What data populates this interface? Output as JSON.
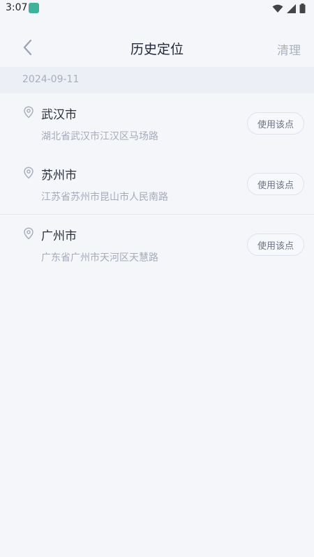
{
  "status": {
    "time": "3:07"
  },
  "header": {
    "title": "历史定位",
    "clear_label": "清理"
  },
  "date_group": "2024-09-11",
  "items": [
    {
      "city": "武汉市",
      "address": "湖北省武汉市江汉区马场路",
      "action": "使用该点"
    },
    {
      "city": "苏州市",
      "address": "江苏省苏州市昆山市人民南路",
      "action": "使用该点"
    },
    {
      "city": "广州市",
      "address": "广东省广州市天河区天慧路",
      "action": "使用该点"
    }
  ],
  "colors": {
    "background": "#f5f6fa",
    "date_bar": "#eceff6",
    "muted_text": "#a5abba",
    "title_text": "#23283a"
  },
  "icons": {
    "back": "chevron-left-icon",
    "pin": "location-pin-icon",
    "wifi": "wifi-icon",
    "signal": "signal-icon",
    "battery": "battery-icon"
  }
}
